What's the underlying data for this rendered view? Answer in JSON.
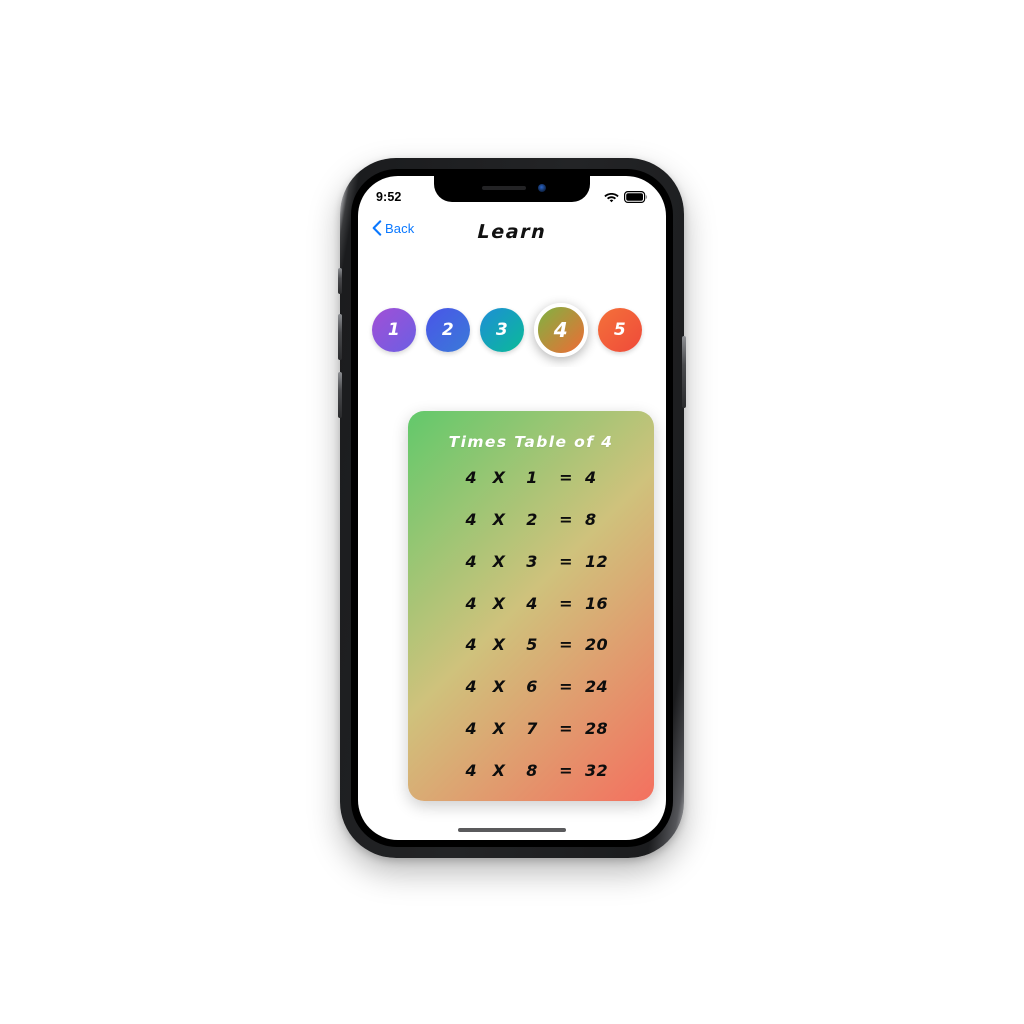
{
  "status_bar": {
    "time": "9:52",
    "wifi_icon": "wifi-icon",
    "battery_icon": "battery-full-icon"
  },
  "nav": {
    "back_label": "Back",
    "back_icon": "chevron-left-icon",
    "title": "Learn"
  },
  "number_selector": {
    "selected": "4",
    "items": [
      {
        "label": "1",
        "gradient_from": "#a24fd6",
        "gradient_to": "#6b5fe3",
        "selected": false
      },
      {
        "label": "2",
        "gradient_from": "#4a55e8",
        "gradient_to": "#3a7ad8",
        "selected": false
      },
      {
        "label": "3",
        "gradient_from": "#1d8ed6",
        "gradient_to": "#0bba98",
        "selected": false
      },
      {
        "label": "4",
        "gradient_from": "#7fb342",
        "gradient_to": "#ef6b35",
        "selected": true
      },
      {
        "label": "5",
        "gradient_from": "#f4713a",
        "gradient_to": "#ef4a3a",
        "selected": false
      }
    ]
  },
  "table_card": {
    "title": "Times Table of 4",
    "gradient_from": "#62c96b",
    "gradient_mid": "#cfc27c",
    "gradient_to": "#f4705f",
    "multiplier": "4",
    "operator": "X",
    "equals": "=",
    "rows": [
      {
        "lhs": "4",
        "op": "X",
        "rhs": "1",
        "eq": "=",
        "result": "4"
      },
      {
        "lhs": "4",
        "op": "X",
        "rhs": "2",
        "eq": "=",
        "result": "8"
      },
      {
        "lhs": "4",
        "op": "X",
        "rhs": "3",
        "eq": "=",
        "result": "12"
      },
      {
        "lhs": "4",
        "op": "X",
        "rhs": "4",
        "eq": "=",
        "result": "16"
      },
      {
        "lhs": "4",
        "op": "X",
        "rhs": "5",
        "eq": "=",
        "result": "20"
      },
      {
        "lhs": "4",
        "op": "X",
        "rhs": "6",
        "eq": "=",
        "result": "24"
      },
      {
        "lhs": "4",
        "op": "X",
        "rhs": "7",
        "eq": "=",
        "result": "28"
      },
      {
        "lhs": "4",
        "op": "X",
        "rhs": "8",
        "eq": "=",
        "result": "32"
      }
    ]
  },
  "home_indicator": "home-indicator"
}
